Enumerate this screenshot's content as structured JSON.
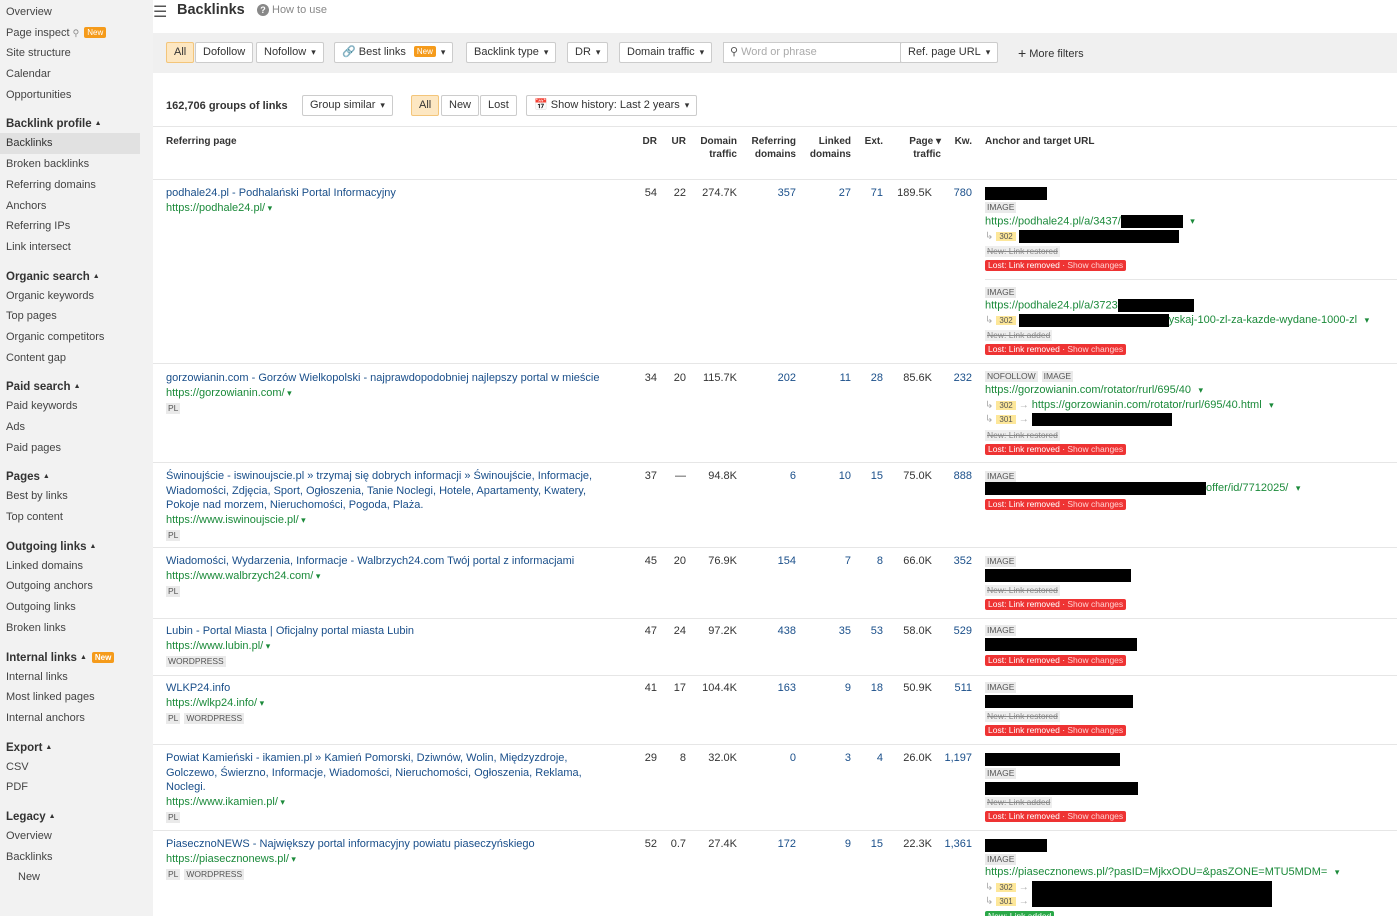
{
  "sidebar": {
    "top_items": [
      {
        "label": "Overview"
      },
      {
        "label": "Page inspect",
        "badge": "New"
      },
      {
        "label": "Site structure"
      },
      {
        "label": "Calendar"
      },
      {
        "label": "Opportunities"
      }
    ],
    "sections": [
      {
        "head": "Backlink profile",
        "items": [
          "Backlinks",
          "Broken backlinks",
          "Referring domains",
          "Anchors",
          "Referring IPs",
          "Link intersect"
        ]
      },
      {
        "head": "Organic search",
        "items": [
          "Organic keywords",
          "Top pages",
          "Organic competitors",
          "Content gap"
        ]
      },
      {
        "head": "Paid search",
        "items": [
          "Paid keywords",
          "Ads",
          "Paid pages"
        ]
      },
      {
        "head": "Pages",
        "items": [
          "Best by links",
          "Top content"
        ]
      },
      {
        "head": "Outgoing links",
        "items": [
          "Linked domains",
          "Outgoing anchors",
          "Outgoing links",
          "Broken links"
        ]
      },
      {
        "head": "Internal links",
        "badge": "New",
        "items": [
          "Internal links",
          "Most linked pages",
          "Internal anchors"
        ]
      },
      {
        "head": "Export",
        "items": [
          "CSV",
          "PDF"
        ]
      },
      {
        "head": "Legacy",
        "items": [
          "Overview",
          "Backlinks",
          "New"
        ]
      }
    ]
  },
  "header": {
    "title": "Backlinks",
    "how_to": "How to use"
  },
  "filters": {
    "all": "All",
    "dofollow": "Dofollow",
    "nofollow": "Nofollow",
    "best_links": "Best links",
    "best_links_badge": "New",
    "backlink_type": "Backlink type",
    "dr": "DR",
    "domain_traffic": "Domain traffic",
    "search_placeholder": "Word or phrase",
    "ref_page_url": "Ref. page URL",
    "more_filters": "More filters"
  },
  "groups": {
    "count_text": "162,706 groups of links",
    "group_similar": "Group similar",
    "all": "All",
    "new": "New",
    "lost": "Lost",
    "history": "Show history: Last 2 years"
  },
  "columns": {
    "referring_page": "Referring page",
    "dr": "DR",
    "ur": "UR",
    "domain_traffic": [
      "Domain",
      "traffic"
    ],
    "referring_domains": [
      "Referring",
      "domains"
    ],
    "linked_domains": [
      "Linked",
      "domains"
    ],
    "ext": "Ext.",
    "page_traffic": [
      "Page ▾",
      "traffic"
    ],
    "kw": "Kw.",
    "anchor": "Anchor and target URL"
  },
  "labels": {
    "image": "IMAGE",
    "nofollow": "NOFOLLOW",
    "r302": "302",
    "r301": "301",
    "new_restored": "New: Link restored",
    "new_added": "New: Link added",
    "lost_removed": "Lost: Link removed",
    "show_changes": "Show changes"
  },
  "rows": [
    {
      "title": "podhale24.pl - Podhalański Portal Informacyjny",
      "url": "https://podhale24.pl/",
      "tags": [],
      "dr": "54",
      "ur": "22",
      "dt": "274.7K",
      "rd": "357",
      "ld": "27",
      "ext": "71",
      "pt": "189.5K",
      "kw": "780",
      "t1": "https://podhale24.pl/a/3437/",
      "t2": "https://podhale24.pl/a/3723",
      "t2_tail": "yskaj-100-zl-za-kazde-wydane-1000-zl"
    },
    {
      "title": "gorzowianin.com - Gorzów Wielkopolski - najprawdopodobniej najlepszy portal w mieście",
      "url": "https://gorzowianin.com/",
      "tags": [
        "PL"
      ],
      "dr": "34",
      "ur": "20",
      "dt": "115.7K",
      "rd": "202",
      "ld": "11",
      "ext": "28",
      "pt": "85.6K",
      "kw": "232",
      "t1": "https://gorzowianin.com/rotator/rurl/695/40",
      "t2": "https://gorzowianin.com/rotator/rurl/695/40.html"
    },
    {
      "title": "Świnoujście - iswinoujscie.pl » trzymaj się dobrych informacji » Świnoujście, Informacje, Wiadomości, Zdjęcia, Sport, Ogłoszenia, Tanie Noclegi, Hotele, Apartamenty, Kwatery, Pokoje nad morzem, Nieruchomości, Pogoda, Plaża.",
      "url": "https://www.iswinoujscie.pl/",
      "tags": [
        "PL"
      ],
      "dr": "37",
      "ur": "—",
      "dt": "94.8K",
      "rd": "6",
      "ld": "10",
      "ext": "15",
      "pt": "75.0K",
      "kw": "888",
      "t1_tail": "offer/id/7712025/"
    },
    {
      "title": "Wiadomości, Wydarzenia, Informacje - Walbrzych24.com Twój portal z informacjami",
      "url": "https://www.walbrzych24.com/",
      "tags": [
        "PL"
      ],
      "dr": "45",
      "ur": "20",
      "dt": "76.9K",
      "rd": "154",
      "ld": "7",
      "ext": "8",
      "pt": "66.0K",
      "kw": "352"
    },
    {
      "title": "Lubin - Portal Miasta | Oficjalny portal miasta Lubin",
      "url": "https://www.lubin.pl/",
      "tags": [
        "WORDPRESS"
      ],
      "dr": "47",
      "ur": "24",
      "dt": "97.2K",
      "rd": "438",
      "ld": "35",
      "ext": "53",
      "pt": "58.0K",
      "kw": "529"
    },
    {
      "title": "WLKP24.info",
      "url": "https://wlkp24.info/",
      "tags": [
        "PL",
        "WORDPRESS"
      ],
      "dr": "41",
      "ur": "17",
      "dt": "104.4K",
      "rd": "163",
      "ld": "9",
      "ext": "18",
      "pt": "50.9K",
      "kw": "511"
    },
    {
      "title": "Powiat Kamieński - ikamien.pl » Kamień Pomorski, Dziwnów, Wolin, Międzyzdroje, Golczewo, Świerzno, Informacje, Wiadomości, Nieruchomości, Ogłoszenia, Reklama, Noclegi.",
      "url": "https://www.ikamien.pl/",
      "tags": [
        "PL"
      ],
      "dr": "29",
      "ur": "8",
      "dt": "32.0K",
      "rd": "0",
      "ld": "3",
      "ext": "4",
      "pt": "26.0K",
      "kw": "1,197"
    },
    {
      "title": "PiasecznoNEWS - Największy portal informacyjny powiatu piaseczyńskiego",
      "url": "https://piasecznonews.pl/",
      "tags": [
        "PL",
        "WORDPRESS"
      ],
      "dr": "52",
      "ur": "0.7",
      "dt": "27.4K",
      "rd": "172",
      "ld": "9",
      "ext": "15",
      "pt": "22.3K",
      "kw": "1,361",
      "t1": "https://piasecznonews.pl/?pasID=MjkxODU=&pasZONE=MTU5MDM="
    }
  ]
}
